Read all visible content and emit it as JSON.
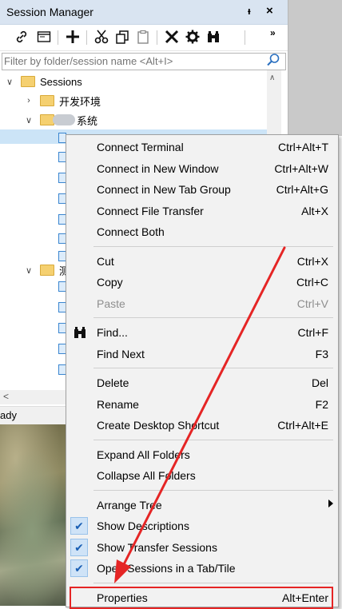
{
  "panel": {
    "title": "Session Manager",
    "pin_icon": "pin-icon",
    "close_label": "×",
    "toolbar_overflow": "»",
    "toolbar_icons": [
      "connect-link-icon",
      "connect-window-icon",
      "add-icon",
      "cut-icon",
      "copy-icon",
      "paste-icon",
      "delete-icon",
      "properties-gear-icon",
      "find-binoculars-icon"
    ]
  },
  "filter": {
    "placeholder": "Filter by folder/session name <Alt+I>",
    "value": ""
  },
  "tree": {
    "root": "Sessions",
    "folders": [
      {
        "label": "开发环境",
        "expanded": false
      },
      {
        "label": "系统",
        "expanded": true,
        "prefix_blurred": true
      }
    ],
    "partially_visible_folder": "测"
  },
  "status": {
    "text": "ady"
  },
  "context_menu": {
    "groups": [
      [
        {
          "label": "Connect Terminal",
          "shortcut": "Ctrl+Alt+T"
        },
        {
          "label": "Connect in New Window",
          "shortcut": "Ctrl+Alt+W"
        },
        {
          "label": "Connect in New Tab Group",
          "shortcut": "Ctrl+Alt+G"
        },
        {
          "label": "Connect File Transfer",
          "shortcut": "Alt+X"
        },
        {
          "label": "Connect Both",
          "shortcut": ""
        }
      ],
      [
        {
          "label": "Cut",
          "shortcut": "Ctrl+X"
        },
        {
          "label": "Copy",
          "shortcut": "Ctrl+C"
        },
        {
          "label": "Paste",
          "shortcut": "Ctrl+V",
          "disabled": true
        }
      ],
      [
        {
          "label": "Find...",
          "shortcut": "Ctrl+F",
          "icon": "binoculars-icon"
        },
        {
          "label": "Find Next",
          "shortcut": "F3"
        }
      ],
      [
        {
          "label": "Delete",
          "shortcut": "Del"
        },
        {
          "label": "Rename",
          "shortcut": "F2"
        },
        {
          "label": "Create Desktop Shortcut",
          "shortcut": "Ctrl+Alt+E"
        }
      ],
      [
        {
          "label": "Expand All Folders",
          "shortcut": ""
        },
        {
          "label": "Collapse All Folders",
          "shortcut": ""
        }
      ],
      [
        {
          "label": "Arrange Tree",
          "shortcut": "",
          "submenu": true
        },
        {
          "label": "Show Descriptions",
          "shortcut": "",
          "checked": true
        },
        {
          "label": "Show Transfer Sessions",
          "shortcut": "",
          "checked": true
        },
        {
          "label": "Open Sessions in a Tab/Tile",
          "shortcut": "",
          "checked": true
        }
      ],
      [
        {
          "label": "Properties",
          "shortcut": "Alt+Enter",
          "highlighted": true
        }
      ]
    ]
  },
  "annotation": {
    "arrow_color": "#e52525",
    "box_color": "#e52525"
  },
  "colors": {
    "titlebar": "#d9e4f1",
    "folder": "#f5d070",
    "session_icon": "#3a86d0",
    "check_bg": "#cfe3f7"
  }
}
